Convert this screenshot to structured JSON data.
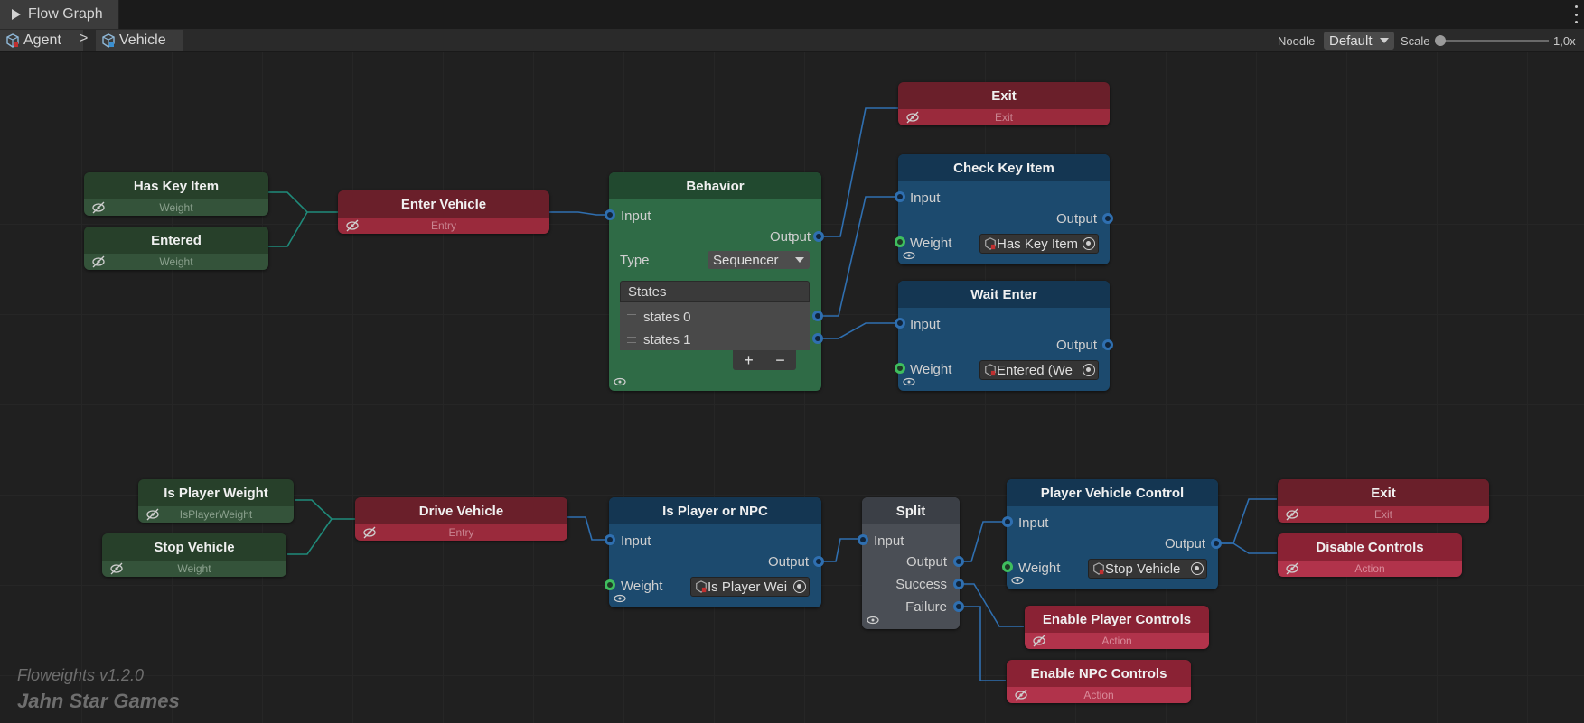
{
  "tab": {
    "title": "Flow Graph"
  },
  "breadcrumb": {
    "agent": "Agent",
    "separator": ">",
    "vehicle": "Vehicle"
  },
  "toolbar": {
    "noodle_label": "Noodle",
    "noodle_value": "Default",
    "scale_label": "Scale",
    "scale_value": "1,0x",
    "scale_level": 0.0
  },
  "nodes": {
    "has_key_item": {
      "title": "Has Key Item",
      "sub": "Weight"
    },
    "entered": {
      "title": "Entered",
      "sub": "Weight"
    },
    "enter_vehicle": {
      "title": "Enter Vehicle",
      "sub": "Entry"
    },
    "behavior": {
      "title": "Behavior",
      "input": "Input",
      "output": "Output",
      "type_label": "Type",
      "type_value": "Sequencer",
      "states_header": "States",
      "states": [
        "states 0",
        "states 1"
      ],
      "add": "+",
      "remove": "−"
    },
    "exit_top": {
      "title": "Exit",
      "sub": "Exit"
    },
    "check_key_item": {
      "title": "Check Key Item",
      "input": "Input",
      "output": "Output",
      "weight": "Weight",
      "weight_value": "Has Key Item"
    },
    "wait_enter": {
      "title": "Wait Enter",
      "input": "Input",
      "output": "Output",
      "weight": "Weight",
      "weight_value": "Entered (We"
    },
    "is_player_weight": {
      "title": "Is Player Weight",
      "sub": "IsPlayerWeight"
    },
    "stop_vehicle": {
      "title": "Stop Vehicle",
      "sub": "Weight"
    },
    "drive_vehicle": {
      "title": "Drive Vehicle",
      "sub": "Entry"
    },
    "is_player_or_npc": {
      "title": "Is Player or NPC",
      "input": "Input",
      "output": "Output",
      "weight": "Weight",
      "weight_value": "Is Player Wei"
    },
    "split": {
      "title": "Split",
      "input": "Input",
      "output": "Output",
      "success": "Success",
      "failure": "Failure"
    },
    "player_vehicle_control": {
      "title": "Player Vehicle Control",
      "input": "Input",
      "output": "Output",
      "weight": "Weight",
      "weight_value": "Stop Vehicle"
    },
    "exit_bottom": {
      "title": "Exit",
      "sub": "Exit"
    },
    "disable_controls": {
      "title": "Disable Controls",
      "sub": "Action"
    },
    "enable_player_controls": {
      "title": "Enable Player Controls",
      "sub": "Action"
    },
    "enable_npc_controls": {
      "title": "Enable NPC Controls",
      "sub": "Action"
    }
  },
  "branding": {
    "version": "Floweights v1.2.0",
    "company": "Jahn Star Games"
  },
  "colors": {
    "wire": "#2f6fb0",
    "wire_teal": "#1f8a7a",
    "entry_red": "#6a1f2a",
    "action_pink": "#b1334b",
    "behavior_green": "#2f6b46",
    "logic_blue": "#1c4a6e"
  }
}
